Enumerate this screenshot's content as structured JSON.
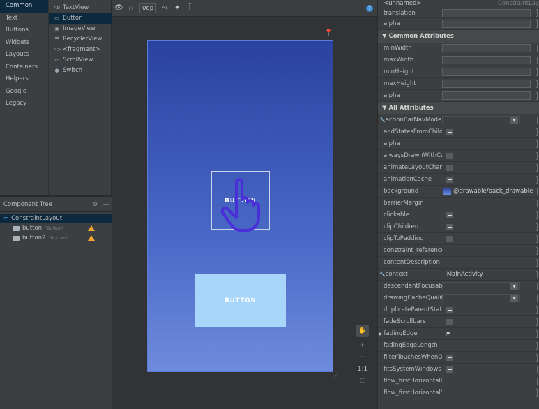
{
  "palette": {
    "categories": [
      "Common",
      "Text",
      "Buttons",
      "Widgets",
      "Layouts",
      "Containers",
      "Helpers",
      "Google",
      "Legacy"
    ],
    "items": [
      {
        "icon": "Ab",
        "label": "TextView"
      },
      {
        "icon": "▭",
        "label": "Button"
      },
      {
        "icon": "▣",
        "label": "ImageView"
      },
      {
        "icon": "☰",
        "label": "RecyclerView"
      },
      {
        "icon": "<>",
        "label": "<fragment>"
      },
      {
        "icon": "▭",
        "label": "ScrollView"
      },
      {
        "icon": "●",
        "label": "Switch"
      }
    ]
  },
  "component_tree": {
    "title": "Component Tree",
    "root": "ConstraintLayout",
    "children": [
      {
        "id": "button",
        "text": "\"Button\""
      },
      {
        "id": "button2",
        "text": "\"Button\""
      }
    ]
  },
  "design": {
    "toolbar": {
      "dp": "0dp"
    },
    "help": "?",
    "button1_text": "BUTTON",
    "button2_text": "BUTTON",
    "zoom_reset": "1:1",
    "colors": {
      "phone_top": "#2a42a0",
      "phone_bottom": "#6e8bdc",
      "button2_bg": "#a8d6fa",
      "hand_stroke": "#4a2ed8"
    }
  },
  "attributes": {
    "header_left": "<unnamed>",
    "header_right": "ConstraintLay",
    "top_rows": [
      "translation",
      "alpha"
    ],
    "common_title": "Common Attributes",
    "common_rows": [
      "minWidth",
      "maxWidth",
      "minHeight",
      "maxHeight",
      "alpha"
    ],
    "all_title": "All Attributes",
    "all_rows": [
      {
        "name": "actionBarNavMode",
        "kind": "dropdown",
        "wrench": true
      },
      {
        "name": "addStatesFromChildr...",
        "kind": "minus"
      },
      {
        "name": "alpha",
        "kind": "none"
      },
      {
        "name": "alwaysDrawnWithCac...",
        "kind": "minus"
      },
      {
        "name": "animateLayoutChanges",
        "kind": "minus"
      },
      {
        "name": "animationCache",
        "kind": "minus"
      },
      {
        "name": "background",
        "kind": "drawable",
        "value": "@drawable/back_drawable"
      },
      {
        "name": "barrierMargin",
        "kind": "none"
      },
      {
        "name": "clickable",
        "kind": "minus"
      },
      {
        "name": "clipChildren",
        "kind": "minus"
      },
      {
        "name": "clipToPadding",
        "kind": "minus"
      },
      {
        "name": "constraint_referenced...",
        "kind": "none"
      },
      {
        "name": "contentDescription",
        "kind": "none"
      },
      {
        "name": "context",
        "kind": "text",
        "value": ".MainActivity",
        "wrench": true
      },
      {
        "name": "descendantFocusability",
        "kind": "dropdown"
      },
      {
        "name": "drawingCacheQuality",
        "kind": "dropdown"
      },
      {
        "name": "duplicateParentState",
        "kind": "minus"
      },
      {
        "name": "fadeScrollbars",
        "kind": "minus"
      },
      {
        "name": "fadingEdge",
        "kind": "flag",
        "expand": true
      },
      {
        "name": "fadingEdgeLength",
        "kind": "none"
      },
      {
        "name": "filterTouchesWhenOb...",
        "kind": "minus"
      },
      {
        "name": "fitsSystemWindows",
        "kind": "minus"
      },
      {
        "name": "flow_firstHorizontalBi...",
        "kind": "none"
      },
      {
        "name": "flow_firstHorizontalSt...",
        "kind": "none"
      }
    ]
  }
}
